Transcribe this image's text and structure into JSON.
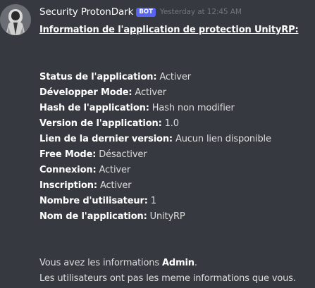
{
  "author": {
    "name": "Security ProtonDark",
    "badge": "BOT",
    "timestamp": "Yesterday at 12:45 AM",
    "avatar_icon": "robed-figure-avatar"
  },
  "message": {
    "title": "Information de l'application de protection UnityRP:",
    "fields": [
      {
        "key": "Status de l'application:",
        "value": " Activer"
      },
      {
        "key": "Développer Mode:",
        "value": " Activer"
      },
      {
        "key": "Hash de l'application:",
        "value": " Hash non modifier"
      },
      {
        "key": "Version de l'application:",
        "value": " 1.0"
      },
      {
        "key": "Lien de la dernier version:",
        "value": " Aucun lien disponible"
      },
      {
        "key": "Free Mode:",
        "value": " Désactiver"
      },
      {
        "key": "Connexion:",
        "value": " Activer"
      },
      {
        "key": "Inscription:",
        "value": " Activer"
      },
      {
        "key": "Nombre d'utilisateur:",
        "value": " 1"
      },
      {
        "key": "Nom de l'application:",
        "value": " UnityRP"
      }
    ],
    "footer": {
      "line1_prefix": "Vous avez les informations ",
      "line1_bold": "Admin",
      "line1_suffix": ".",
      "line2": "Les utilisateurs ont pas les meme informations que vous."
    }
  },
  "colors": {
    "background": "#36393f",
    "username": "#ffffff",
    "bot_badge": "#5865f2",
    "timestamp": "#72767d",
    "text": "#dcddde"
  }
}
